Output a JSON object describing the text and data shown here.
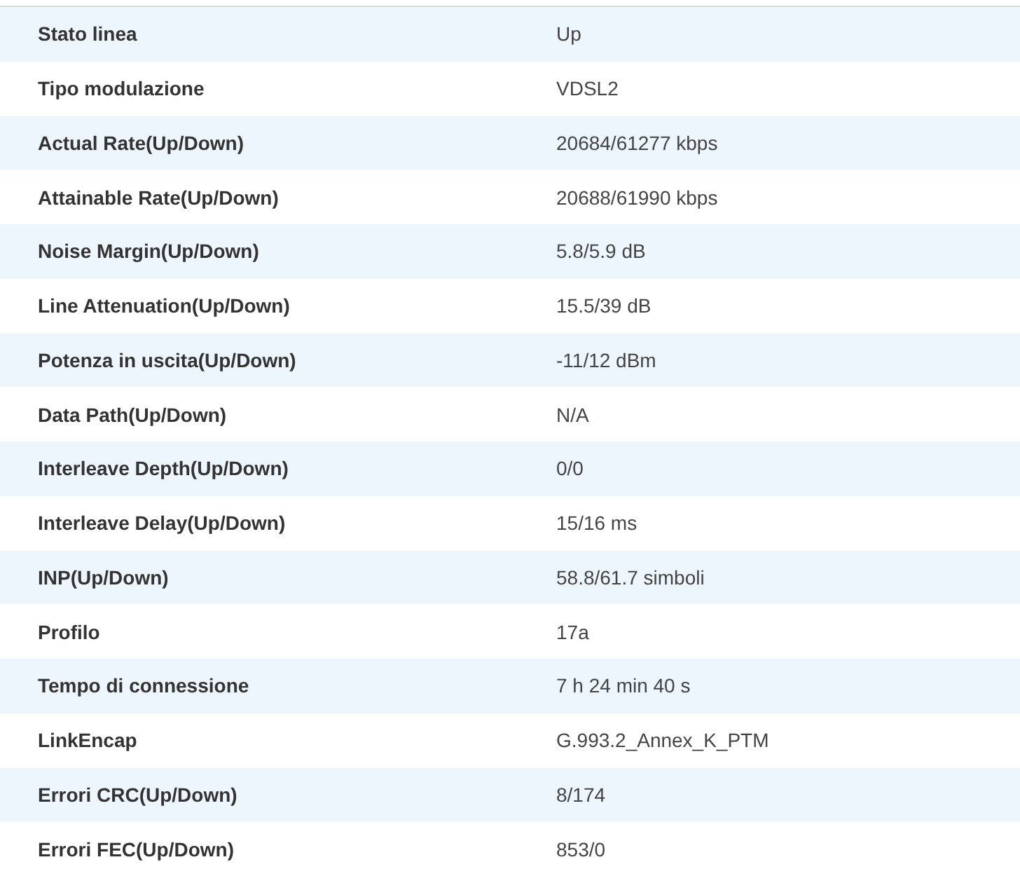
{
  "rows": [
    {
      "label": "Stato linea",
      "value": "Up"
    },
    {
      "label": "Tipo modulazione",
      "value": "VDSL2"
    },
    {
      "label": "Actual Rate(Up/Down)",
      "value": "20684/61277 kbps"
    },
    {
      "label": "Attainable Rate(Up/Down)",
      "value": "20688/61990 kbps"
    },
    {
      "label": "Noise Margin(Up/Down)",
      "value": "5.8/5.9 dB"
    },
    {
      "label": "Line Attenuation(Up/Down)",
      "value": "15.5/39 dB"
    },
    {
      "label": "Potenza in uscita(Up/Down)",
      "value": "-11/12 dBm"
    },
    {
      "label": "Data Path(Up/Down)",
      "value": "N/A"
    },
    {
      "label": "Interleave Depth(Up/Down)",
      "value": "0/0"
    },
    {
      "label": "Interleave Delay(Up/Down)",
      "value": "15/16 ms"
    },
    {
      "label": "INP(Up/Down)",
      "value": "58.8/61.7 simboli"
    },
    {
      "label": "Profilo",
      "value": "17a"
    },
    {
      "label": "Tempo di connessione",
      "value": "7 h 24 min 40 s"
    },
    {
      "label": "LinkEncap",
      "value": "G.993.2_Annex_K_PTM"
    },
    {
      "label": "Errori CRC(Up/Down)",
      "value": "8/174"
    },
    {
      "label": "Errori FEC(Up/Down)",
      "value": "853/0"
    }
  ]
}
